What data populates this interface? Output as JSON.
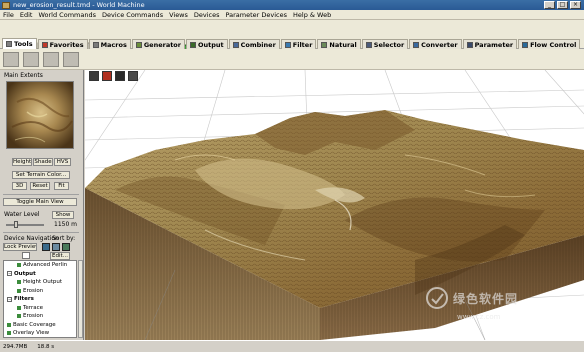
{
  "window": {
    "title": "new_erosion_result.tmd - World Machine",
    "min": "_",
    "max": "□",
    "close": "×"
  },
  "menu": [
    "File",
    "Edit",
    "World Commands",
    "Device Commands",
    "Views",
    "Devices",
    "Parameter Devices",
    "Help & Web"
  ],
  "tabs": [
    {
      "label": "Tools",
      "active": true,
      "color": "#808080"
    },
    {
      "label": "Favorites",
      "color": "#c0392b"
    },
    {
      "label": "Macros",
      "color": "#7a7a7a"
    },
    {
      "label": "Generator",
      "color": "#6a8f3a"
    },
    {
      "label": "Output",
      "color": "#3a6a2a"
    },
    {
      "label": "Combiner",
      "color": "#4a6a9a"
    },
    {
      "label": "Filter",
      "color": "#3a7ab0"
    },
    {
      "label": "Natural",
      "color": "#6a8a5a"
    },
    {
      "label": "Selector",
      "color": "#4a5a7a"
    },
    {
      "label": "Converter",
      "color": "#3a6aa0"
    },
    {
      "label": "Parameter",
      "color": "#3a4a6a"
    },
    {
      "label": "Flow Control",
      "color": "#2a6a9a"
    }
  ],
  "left": {
    "main_extents": "Main Extents",
    "height_btn": "Height",
    "shade_btn": "Shade",
    "hvs_btn": "HVS",
    "set_terrain_color": "Set Terrain Color...",
    "btn_3d": "3D",
    "btn_reset": "Reset",
    "btn_fit": "Fit",
    "toggle_main_view": "Toggle Main View",
    "water_level": "Water Level",
    "water_show": "Show",
    "water_value": "1150 m",
    "device_navigation": "Device Navigation",
    "sort_by": "Sort by:",
    "lock_preview": "Lock Preview",
    "edit_btn": "Edit...",
    "tree": [
      {
        "label": "Advanced Perlin",
        "level": 1
      },
      {
        "label": "Output",
        "level": 0,
        "group": true
      },
      {
        "label": "Height Output",
        "level": 1
      },
      {
        "label": "Erosion",
        "level": 1
      },
      {
        "label": "Filters",
        "level": 0,
        "group": true
      },
      {
        "label": "Terrace",
        "level": 1
      },
      {
        "label": "Erosion",
        "level": 1
      },
      {
        "label": "Basic Coverage",
        "level": 0
      },
      {
        "label": "Overlay View",
        "level": 0
      }
    ]
  },
  "status": {
    "memory": "294.7MB",
    "time": "18.8 s"
  },
  "watermark": {
    "text": "绿色软件园",
    "url": "www.cz.com"
  },
  "colors": {
    "title_bar": "#2a5a95",
    "panel": "#d4d0c8",
    "viewport": "#ffffff",
    "terrain": "#a08850",
    "cliff": "#6a5030"
  }
}
